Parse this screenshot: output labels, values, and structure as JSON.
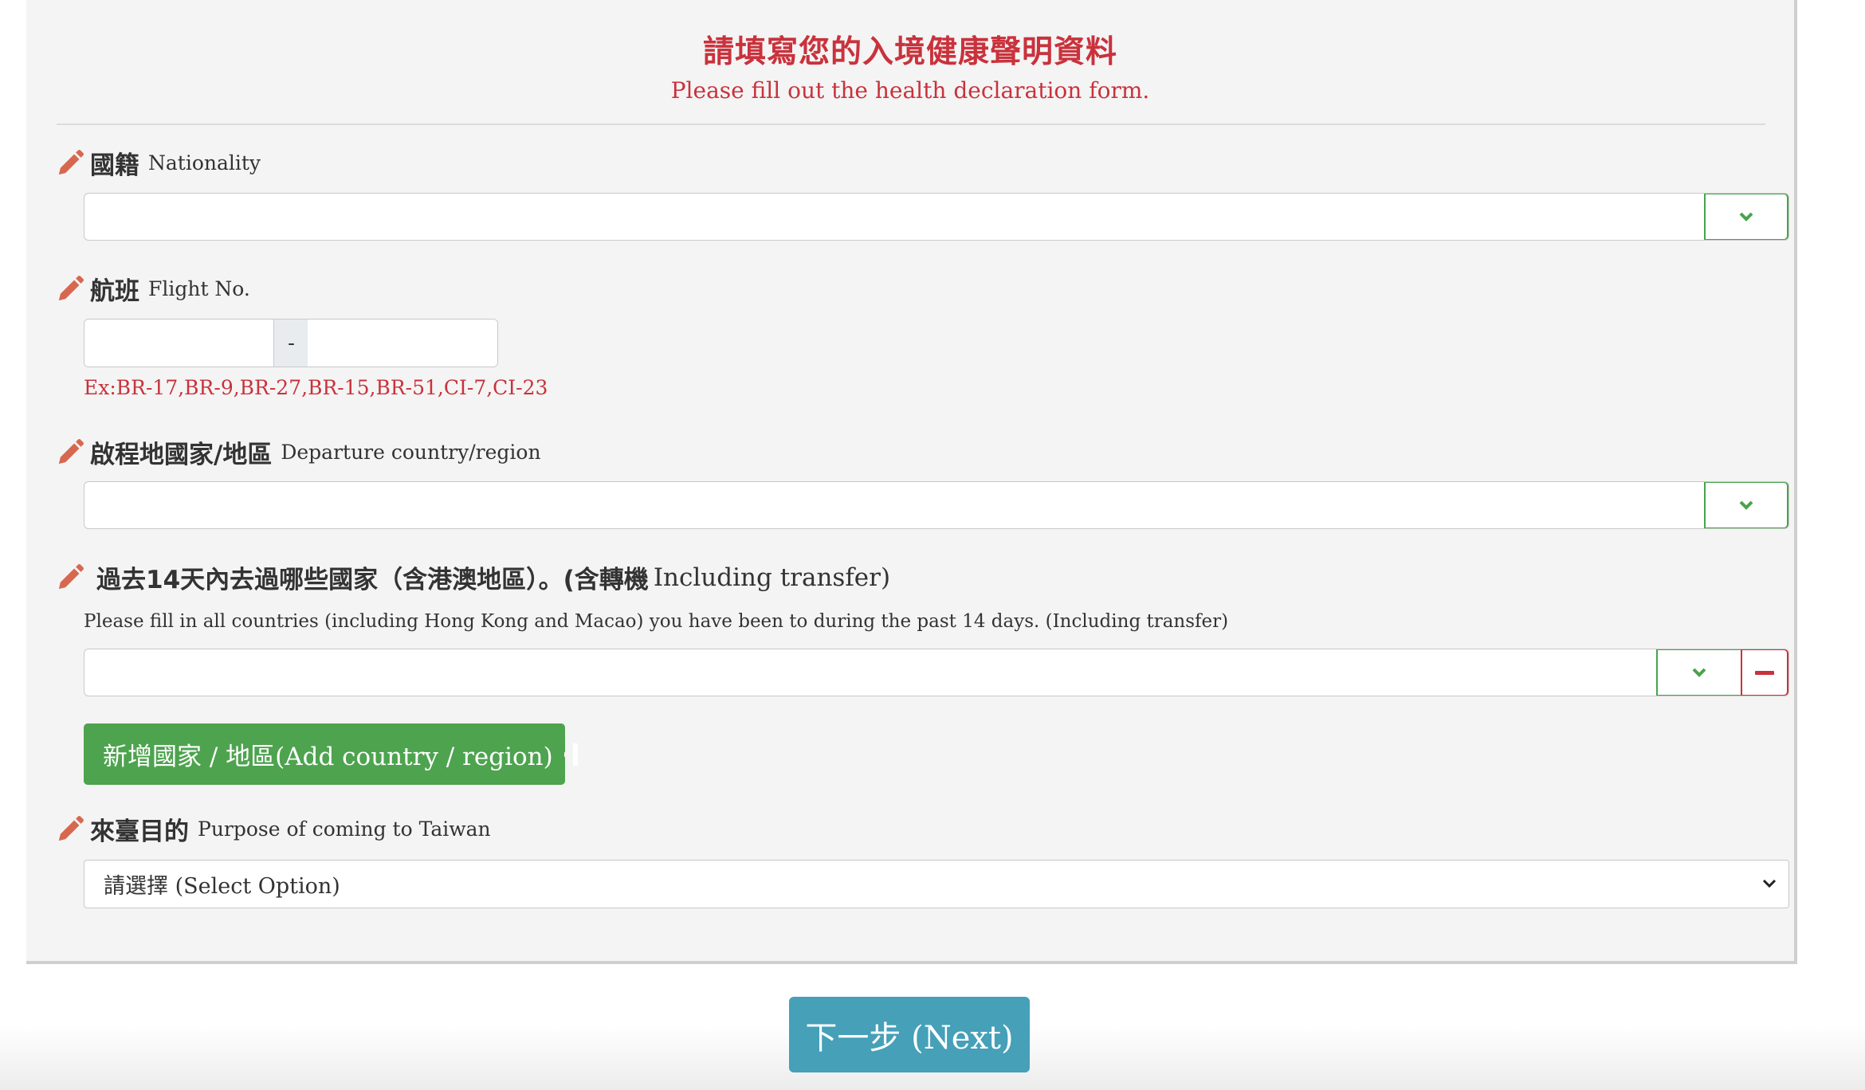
{
  "header": {
    "title_zh": "請填寫您的入境健康聲明資料",
    "title_en": "Please fill out the health declaration form."
  },
  "nationality": {
    "label_zh": "國籍",
    "label_en": "Nationality",
    "value": ""
  },
  "flight": {
    "label_zh": "航班",
    "label_en": "Flight No.",
    "airline_value": "",
    "separator": "-",
    "number_value": "",
    "example": "Ex:BR-17,BR-9,BR-27,BR-15,BR-51,CI-7,CI-23"
  },
  "departure": {
    "label_zh": "啟程地國家/地區",
    "label_en": "Departure country/region",
    "value": ""
  },
  "visited": {
    "label_zh": "過去14天內去過哪些國家（含港澳地區）。(含轉機",
    "label_en": "Including transfer)",
    "help": "Please fill in all countries (including Hong Kong and Macao) you have been to during the past 14 days. (Including transfer)",
    "value": "",
    "add_button": "新增國家 / 地區(Add country / region)"
  },
  "purpose": {
    "label_zh": "來臺目的",
    "label_en": "Purpose of coming to Taiwan",
    "selected": "請選擇 (Select Option)"
  },
  "next_button": "下一步 (Next)",
  "colors": {
    "accent_red": "#c9323c",
    "pencil": "#d7684f",
    "green": "#4ea34f",
    "next_blue": "#45a0b8"
  }
}
